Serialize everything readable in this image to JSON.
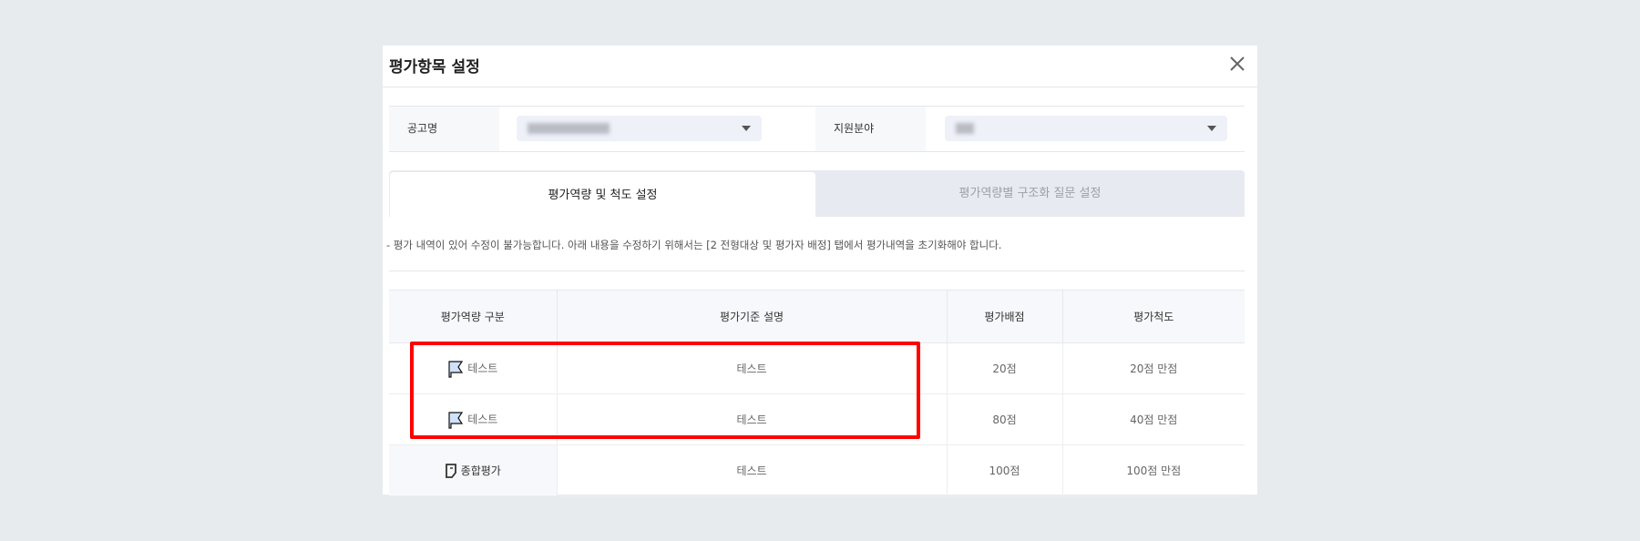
{
  "modal": {
    "title": "평가항목 설정",
    "close_icon": "close-icon"
  },
  "filters": {
    "posting_label": "공고명",
    "field_label": "지원분야"
  },
  "tabs": [
    {
      "label": "평가역량 및 척도 설정",
      "active": true
    },
    {
      "label": "평가역량별 구조화 질문 설정",
      "active": false
    }
  ],
  "notice": "- 평가 내역이 있어 수정이 불가능합니다. 아래 내용을 수정하기 위해서는 [2 전형대상 및 평가자 배정] 탭에서 평가내역을 초기화해야 합니다.",
  "table": {
    "headers": [
      "평가역량 구분",
      "평가기준 설명",
      "평가배점",
      "평가척도"
    ],
    "rows": [
      {
        "category": "테스트",
        "description": "테스트",
        "score": "20점",
        "scale": "20점 만점",
        "icon": "flag-icon"
      },
      {
        "category": "테스트",
        "description": "테스트",
        "score": "80점",
        "scale": "40점 만점",
        "icon": "flag-icon"
      },
      {
        "category": "종합평가",
        "description": "테스트",
        "score": "100점",
        "scale": "100점 만점",
        "icon": "note-icon"
      }
    ]
  },
  "colors": {
    "highlight": "#ff0000",
    "background": "#e8ebee",
    "select_bg": "#eef1f8"
  }
}
